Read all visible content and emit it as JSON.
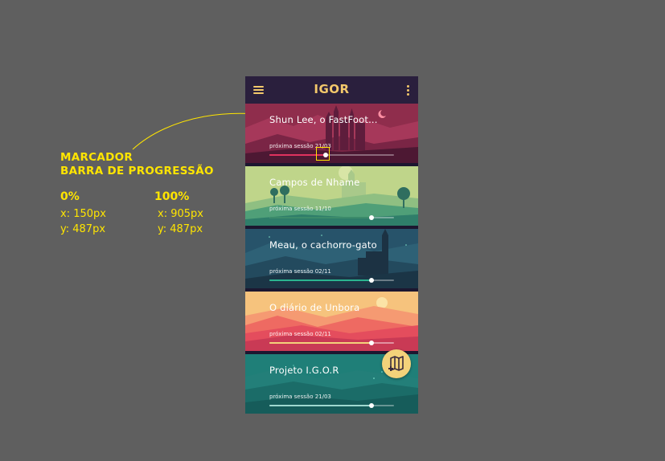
{
  "annotation": {
    "title_line1": "MARCADOR",
    "title_line2": "BARRA DE PROGRESSÃO",
    "start": {
      "label": "0%",
      "x": "x: 150px",
      "y": "y: 487px"
    },
    "end": {
      "label": "100%",
      "x": "x: 905px",
      "y": "y: 487px"
    },
    "accent": "#ffe500"
  },
  "app": {
    "title": "IGOR",
    "menu_icon": "hamburger-menu-icon",
    "more_icon": "kebab-menu-icon"
  },
  "campaigns": [
    {
      "title": "Shun Lee, o FastFoot...",
      "session": "próxima sessão 21/03",
      "progress": 0.45,
      "accent": "#e0325f",
      "theme": "castle-night"
    },
    {
      "title": "Campos de Nhame",
      "session": "próxima sessão 11/10",
      "progress": 0.82,
      "accent": "#3c8b6a",
      "theme": "green-fields"
    },
    {
      "title": "Meau, o cachorro-gato",
      "session": "próxima sessão 02/11",
      "progress": 0.82,
      "accent": "#2bb38f",
      "theme": "dark-castle"
    },
    {
      "title": "O diário de Unbora",
      "session": "próxima sessão 02/11",
      "progress": 0.82,
      "accent": "#f3d27a",
      "theme": "sunset-mountains"
    },
    {
      "title": "Projeto I.G.O.R",
      "session": "próxima sessão 21/03",
      "progress": 0.82,
      "accent": "#9fd8cf",
      "theme": "teal-night"
    }
  ],
  "fab": {
    "icon": "add-map-icon"
  }
}
